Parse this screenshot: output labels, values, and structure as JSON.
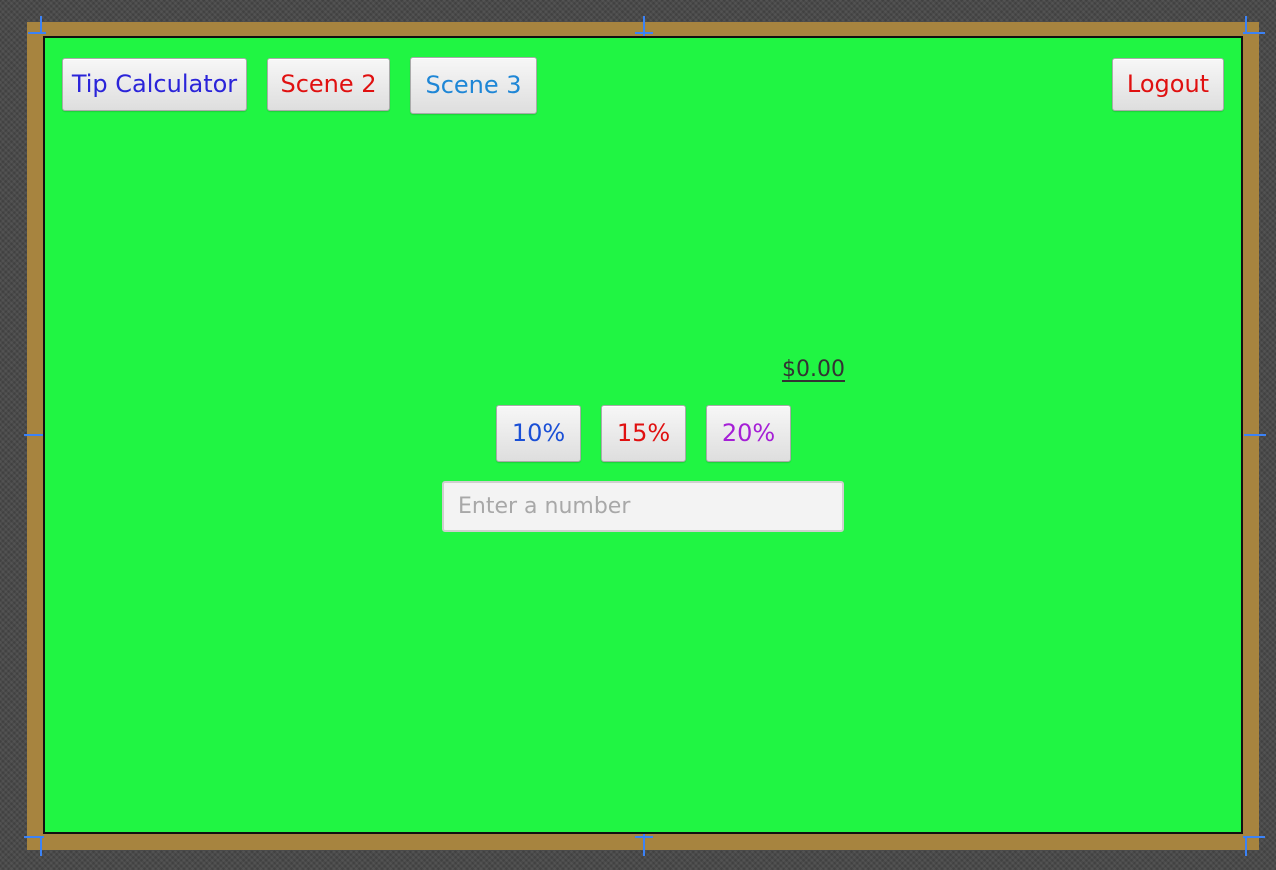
{
  "nav": {
    "tip_calculator": {
      "label": "Tip Calculator",
      "color": "#2b24d9"
    },
    "scene2": {
      "label": "Scene 2",
      "color": "#e01010"
    },
    "scene3": {
      "label": "Scene 3",
      "color": "#1e86d6"
    },
    "logout": {
      "label": "Logout",
      "color": "#e01010"
    }
  },
  "tip": {
    "amount": "$0.00",
    "options": [
      {
        "label": "10%",
        "color": "#1a4fd6"
      },
      {
        "label": "15%",
        "color": "#e01010"
      },
      {
        "label": "20%",
        "color": "#a51fd6"
      }
    ]
  },
  "bill_input": {
    "value": "",
    "placeholder": "Enter a number"
  },
  "colors": {
    "scene_background": "#20f543",
    "frame": "#a7843f",
    "guides": "#3b82f6"
  }
}
